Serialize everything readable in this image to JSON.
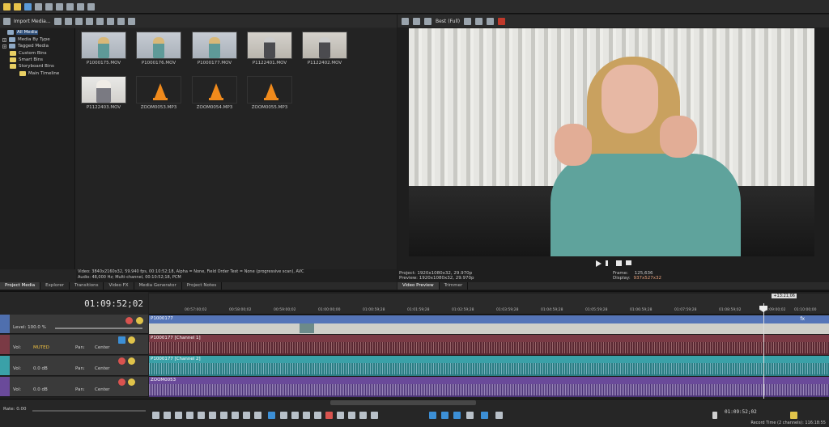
{
  "toolbar": {
    "import_label": "Import Media..."
  },
  "explorer": {
    "tree": [
      {
        "label": "All Media",
        "selected": true
      },
      {
        "label": "Media By Type"
      },
      {
        "label": "Tagged Media"
      },
      {
        "label": "Custom Bins"
      },
      {
        "label": "Smart Bins"
      },
      {
        "label": "Storyboard Bins"
      },
      {
        "label": "Main Timeline"
      }
    ],
    "media": [
      {
        "name": "P1000175.MOV",
        "kind": "woman"
      },
      {
        "name": "P1000176.MOV",
        "kind": "woman"
      },
      {
        "name": "P1000177.MOV",
        "kind": "woman"
      },
      {
        "name": "P1122401.MOV",
        "kind": "man"
      },
      {
        "name": "P1122402.MOV",
        "kind": "man"
      },
      {
        "name": "P1122403.MOV",
        "kind": "man2"
      },
      {
        "name": "ZOOM0053.MP3",
        "kind": "audio"
      },
      {
        "name": "ZOOM0054.MP3",
        "kind": "audio"
      },
      {
        "name": "ZOOM0055.MP3",
        "kind": "audio"
      }
    ],
    "info_video": "Video: 3840x2160x32, 59.940 fps, 00:10:52;18, Alpha = None, Field Order Test = None (progressive scan), AVC",
    "info_audio": "Audio: 48,000 Hz; Multi-channel, 00:10:52;18, PCM",
    "tabs": [
      "Project Media",
      "Explorer",
      "Transitions",
      "Video FX",
      "Media Generator",
      "Project Notes"
    ]
  },
  "preview": {
    "quality": "Best (Full)",
    "project": "Project:   1920x1080x32, 29.970p",
    "preview_res": "Preview:   1920x1080x32, 29.970p",
    "frame_label": "Frame:",
    "frame_value": "125,636",
    "display_label": "Display:",
    "display_value": "937x527x32",
    "tabs": [
      "Video Preview",
      "Trimmer"
    ]
  },
  "timeline": {
    "timecode": "01:09:52;02",
    "level": "Level: 100.0 %",
    "cursor_time": "+13:21;06",
    "ruler": [
      "00:57:00;02",
      "00:58:00;02",
      "00:59:00;02",
      "01:00:00;00",
      "01:00:59;28",
      "01:01:59;28",
      "01:02:59;28",
      "01:03:59;28",
      "01:04:59;28",
      "01:05:59;28",
      "01:06:59;28",
      "01:07:59;28",
      "01:08:59;02",
      "01:09:00;02",
      "01:10:00;00"
    ],
    "tracks": [
      {
        "name": "P1000177",
        "color": "#5575b8"
      },
      {
        "name": "P1000177 [Channel 1]",
        "color": "#7a3a45"
      },
      {
        "name": "P1000177 [Channel 2]",
        "color": "#3aa1a8"
      },
      {
        "name": "ZOOM0053",
        "color": "#6a4a9a"
      }
    ],
    "audio_headers": [
      {
        "vol_label": "Vol:",
        "vol_value": "MUTED",
        "pan_label": "Pan:",
        "pan_value": "Center"
      },
      {
        "vol_label": "Vol:",
        "vol_value": "0.0 dB",
        "pan_label": "Pan:",
        "pan_value": "Center"
      },
      {
        "vol_label": "Vol:",
        "vol_value": "0.0 dB",
        "pan_label": "Pan:",
        "pan_value": "Center"
      }
    ],
    "rate": "Rate: 0.00",
    "bottom_time": "01:09:52;02",
    "record_time": "Record Time (2 channels): 116:18:55"
  }
}
